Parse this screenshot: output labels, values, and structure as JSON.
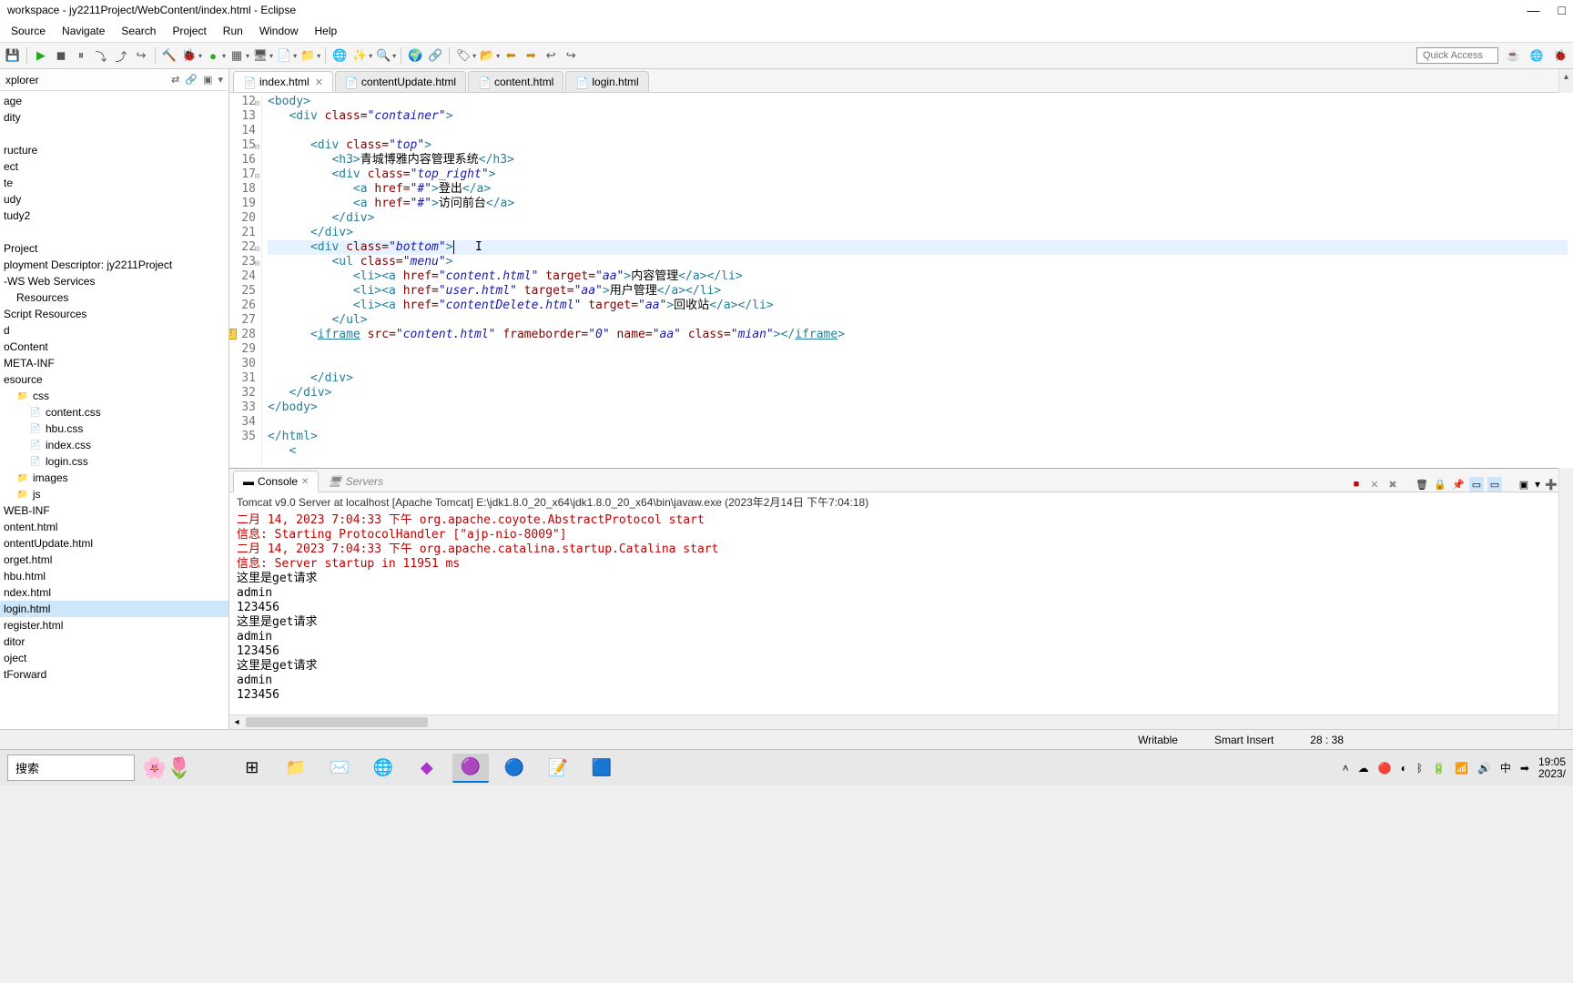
{
  "window": {
    "title": "workspace - jy2211Project/WebContent/index.html - Eclipse"
  },
  "menus": [
    "Source",
    "Navigate",
    "Search",
    "Project",
    "Run",
    "Window",
    "Help"
  ],
  "quick_access": "Quick Access",
  "explorer": {
    "title": "xplorer",
    "items": [
      {
        "label": "age",
        "indent": 0
      },
      {
        "label": "dity",
        "indent": 0
      },
      {
        "label": "",
        "indent": 0,
        "blank": true
      },
      {
        "label": "ructure",
        "indent": 0
      },
      {
        "label": "ect",
        "indent": 0
      },
      {
        "label": "te",
        "indent": 0
      },
      {
        "label": "udy",
        "indent": 0
      },
      {
        "label": "tudy2",
        "indent": 0
      },
      {
        "label": "",
        "indent": 0,
        "blank": true
      },
      {
        "label": "Project",
        "indent": 0
      },
      {
        "label": "ployment Descriptor: jy2211Project",
        "indent": 0
      },
      {
        "label": "-WS Web Services",
        "indent": 0
      },
      {
        "label": "Resources",
        "indent": 1
      },
      {
        "label": "Script Resources",
        "indent": 0
      },
      {
        "label": "d",
        "indent": 0
      },
      {
        "label": "oContent",
        "indent": 0
      },
      {
        "label": "META-INF",
        "indent": 0
      },
      {
        "label": "esource",
        "indent": 0
      },
      {
        "label": "css",
        "indent": 1,
        "icon": "folder"
      },
      {
        "label": "content.css",
        "indent": 2,
        "icon": "file"
      },
      {
        "label": "hbu.css",
        "indent": 2,
        "icon": "file"
      },
      {
        "label": "index.css",
        "indent": 2,
        "icon": "file"
      },
      {
        "label": "login.css",
        "indent": 2,
        "icon": "file"
      },
      {
        "label": "images",
        "indent": 1,
        "icon": "folder"
      },
      {
        "label": "js",
        "indent": 1,
        "icon": "folder"
      },
      {
        "label": "WEB-INF",
        "indent": 0
      },
      {
        "label": "ontent.html",
        "indent": 0
      },
      {
        "label": "ontentUpdate.html",
        "indent": 0
      },
      {
        "label": "orget.html",
        "indent": 0
      },
      {
        "label": "hbu.html",
        "indent": 0
      },
      {
        "label": "ndex.html",
        "indent": 0
      },
      {
        "label": "login.html",
        "indent": 0,
        "selected": true
      },
      {
        "label": "register.html",
        "indent": 0
      },
      {
        "label": "ditor",
        "indent": 0
      },
      {
        "label": "oject",
        "indent": 0
      },
      {
        "label": "tForward",
        "indent": 0
      }
    ]
  },
  "tabs": [
    {
      "label": "index.html",
      "active": true,
      "close": true
    },
    {
      "label": "contentUpdate.html",
      "active": false
    },
    {
      "label": "content.html",
      "active": false
    },
    {
      "label": "login.html",
      "active": false
    }
  ],
  "code": {
    "lines": [
      {
        "n": 12,
        "fold": true,
        "html": "<span class='tag'>&lt;body&gt;</span>"
      },
      {
        "n": 13,
        "html": "   <span class='tag'>&lt;div</span> <span class='attr'>class=</span><span class='str'>\"container\"</span><span class='tag'>&gt;</span>"
      },
      {
        "n": 14,
        "html": ""
      },
      {
        "n": 15,
        "fold": true,
        "html": "      <span class='tag'>&lt;div</span> <span class='attr'>class=</span><span class='str'>\"top\"</span><span class='tag'>&gt;</span>"
      },
      {
        "n": 16,
        "html": "         <span class='tag'>&lt;h3&gt;</span><span class='txt'>青城博雅内容管理系统</span><span class='tag'>&lt;/h3&gt;</span>"
      },
      {
        "n": 17,
        "fold": true,
        "html": "         <span class='tag'>&lt;div</span> <span class='attr'>class=</span><span class='str'>\"top_right\"</span><span class='tag'>&gt;</span>"
      },
      {
        "n": 18,
        "html": "            <span class='tag'>&lt;a</span> <span class='attr'>href=</span><span class='str'>\"#\"</span><span class='tag'>&gt;</span><span class='txt'>登出</span><span class='tag'>&lt;/a&gt;</span>"
      },
      {
        "n": 19,
        "html": "            <span class='tag'>&lt;a</span> <span class='attr'>href=</span><span class='str'>\"#\"</span><span class='tag'>&gt;</span><span class='txt'>访问前台</span><span class='tag'>&lt;/a&gt;</span>"
      },
      {
        "n": 20,
        "html": "         <span class='tag'>&lt;/div&gt;</span>"
      },
      {
        "n": 21,
        "html": "      <span class='tag'>&lt;/div&gt;</span>"
      },
      {
        "n": 22,
        "fold": true,
        "hl": true,
        "html": "      <span class='tag'>&lt;div</span> <span class='attr'>class=</span><span class='str'>\"bottom\"</span><span class='tag'>&gt;</span><span class='cursor-mark'></span>   I"
      },
      {
        "n": 23,
        "fold": true,
        "html": "         <span class='tag'>&lt;ul</span> <span class='attr'>class=</span><span class='str'>\"menu\"</span><span class='tag'>&gt;</span>"
      },
      {
        "n": 24,
        "html": "            <span class='tag'>&lt;li&gt;&lt;a</span> <span class='attr'>href=</span><span class='str'>\"content.html\"</span> <span class='attr'>target=</span><span class='str'>\"aa\"</span><span class='tag'>&gt;</span><span class='txt'>内容管理</span><span class='tag'>&lt;/a&gt;&lt;/li&gt;</span>"
      },
      {
        "n": 25,
        "html": "            <span class='tag'>&lt;li&gt;&lt;a</span> <span class='attr'>href=</span><span class='str'>\"user.html\"</span> <span class='attr'>target=</span><span class='str'>\"aa\"</span><span class='tag'>&gt;</span><span class='txt'>用户管理</span><span class='tag'>&lt;/a&gt;&lt;/li&gt;</span>"
      },
      {
        "n": 26,
        "html": "            <span class='tag'>&lt;li&gt;&lt;a</span> <span class='attr'>href=</span><span class='str'>\"contentDelete.html\"</span> <span class='attr'>target=</span><span class='str'>\"aa\"</span><span class='tag'>&gt;</span><span class='txt'>回收站</span><span class='tag'>&lt;/a&gt;&lt;/li&gt;</span>"
      },
      {
        "n": 27,
        "html": "         <span class='tag'>&lt;/ul&gt;</span>"
      },
      {
        "n": 28,
        "warn": true,
        "html": "      <span class='tag'>&lt;<u>iframe</u></span> <span class='attr'>src=</span><span class='str'>\"content.html\"</span> <span class='attr'>frameborder=</span><span class='str'>\"0\"</span> <span class='attr'>name=</span><span class='str'>\"aa\"</span> <span class='attr'>class=</span><span class='str'>\"mian\"</span><span class='tag'>&gt;&lt;/<u>iframe</u>&gt;</span>"
      },
      {
        "n": 29,
        "html": ""
      },
      {
        "n": 30,
        "html": ""
      },
      {
        "n": 31,
        "html": "      <span class='tag'>&lt;/div&gt;</span>"
      },
      {
        "n": 32,
        "html": "   <span class='tag'>&lt;/div&gt;</span>"
      },
      {
        "n": 33,
        "html": "<span class='tag'>&lt;/body&gt;</span>"
      },
      {
        "n": 34,
        "html": ""
      },
      {
        "n": 35,
        "html": "<span class='tag'>&lt;/html&gt;</span>"
      },
      {
        "n": "",
        "html": "   <span class='tag'>&lt;</span>"
      }
    ]
  },
  "console": {
    "tab1": "Console",
    "tab2": "Servers",
    "title": "Tomcat v9.0 Server at localhost [Apache Tomcat] E:\\jdk1.8.0_20_x64\\jdk1.8.0_20_x64\\bin\\javaw.exe (2023年2月14日 下午7:04:18)",
    "lines": [
      {
        "cls": "red",
        "t": "二月 14, 2023 7:04:33 下午 org.apache.coyote.AbstractProtocol start"
      },
      {
        "cls": "red",
        "t": "信息: Starting ProtocolHandler [\"ajp-nio-8009\"]"
      },
      {
        "cls": "red",
        "t": "二月 14, 2023 7:04:33 下午 org.apache.catalina.startup.Catalina start"
      },
      {
        "cls": "red",
        "t": "信息: Server startup in 11951 ms"
      },
      {
        "cls": "",
        "t": "这里是get请求"
      },
      {
        "cls": "",
        "t": "admin"
      },
      {
        "cls": "",
        "t": "123456"
      },
      {
        "cls": "",
        "t": "这里是get请求"
      },
      {
        "cls": "",
        "t": "admin"
      },
      {
        "cls": "",
        "t": "123456"
      },
      {
        "cls": "",
        "t": "这里是get请求"
      },
      {
        "cls": "",
        "t": "admin"
      },
      {
        "cls": "",
        "t": "123456"
      }
    ]
  },
  "status": {
    "writable": "Writable",
    "insert": "Smart Insert",
    "pos": "28 : 38"
  },
  "taskbar": {
    "search": "搜索",
    "ime": "中",
    "time": "19:05",
    "date": "2023/"
  }
}
